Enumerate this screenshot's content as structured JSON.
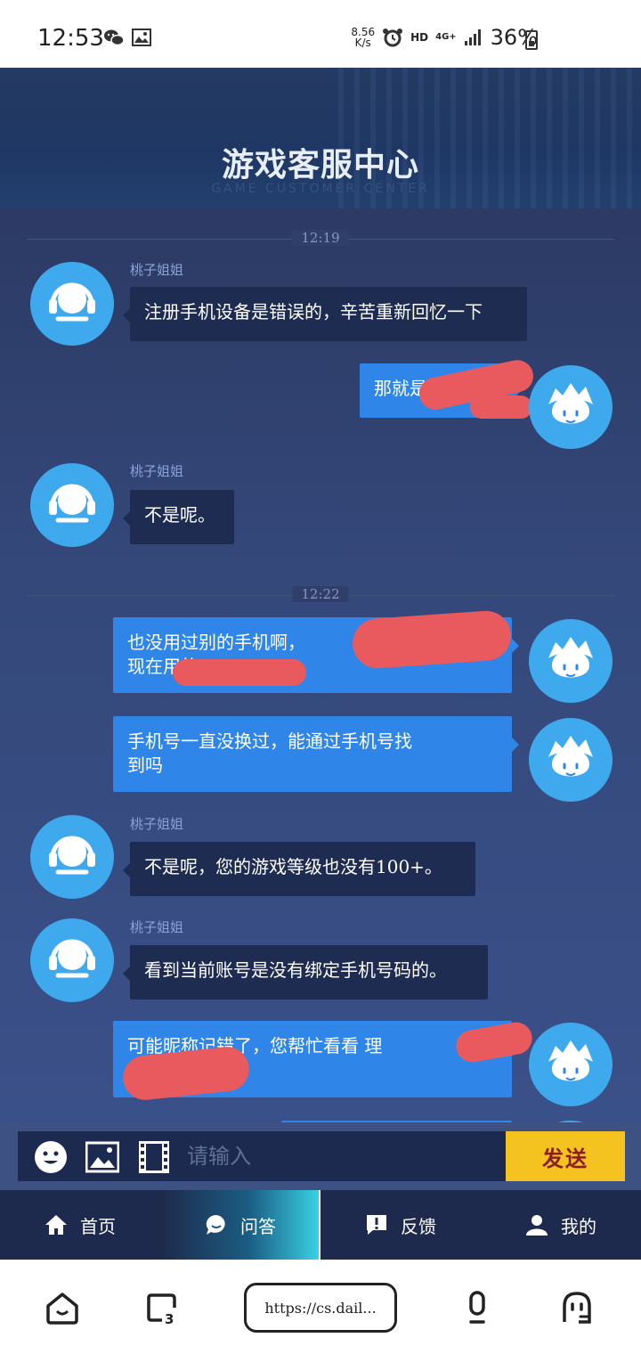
{
  "status_bar": {
    "time": "12:53",
    "speed_value": "8.56",
    "speed_unit": "K/s",
    "hd": "HD",
    "network": "4G+",
    "battery": "36%"
  },
  "header": {
    "title": "游戏客服中心",
    "subtitle": "GAME CUSTOMER CENTER"
  },
  "chat": {
    "timestamps": [
      "12:19",
      "12:22"
    ],
    "messages": [
      {
        "from": "agent",
        "sender": "桃子姐姐",
        "text": "注册手机设备是错误的，辛苦重新回忆一下"
      },
      {
        "from": "user",
        "text": "那就是"
      },
      {
        "from": "agent",
        "sender": "桃子姐姐",
        "text": "不是呢。"
      },
      {
        "from": "user",
        "line1": "也没用过别的手机啊，",
        "line2": "现在用的"
      },
      {
        "from": "user",
        "line1": "手机号一直没换过，能通过手机号找",
        "line2": "到吗"
      },
      {
        "from": "agent",
        "sender": "桃子姐姐",
        "text": "不是呢，您的游戏等级也没有100+。"
      },
      {
        "from": "agent",
        "sender": "桃子姐姐",
        "text": "看到当前账号是没有绑定手机号码的。"
      },
      {
        "from": "user",
        "line1": "可能昵称记错了，您帮忙看看 理"
      }
    ]
  },
  "input": {
    "placeholder": "请输入",
    "send_label": "发送"
  },
  "nav": {
    "items": [
      {
        "label": "首页"
      },
      {
        "label": "问答"
      },
      {
        "label": "反馈"
      },
      {
        "label": "我的"
      }
    ]
  },
  "browser": {
    "url": "https://cs.dail..."
  },
  "colors": {
    "accent": "#2f86e8",
    "agent_bubble": "#1f2c52",
    "send_button": "#f4c31f",
    "redaction": "#e85a5d"
  }
}
